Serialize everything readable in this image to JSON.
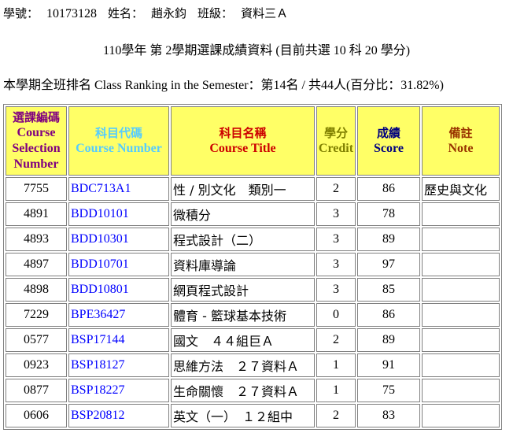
{
  "header": {
    "student_id_label": "學號：",
    "student_id": "10173128",
    "name_label": "姓名：",
    "name": "趙永鈞",
    "class_label": "班級：",
    "class_name": "資料三Ａ"
  },
  "subtitle": "110學年 第 2學期選課成績資料 (目前共選 10 科 20 學分)",
  "ranking": "本學期全班排名 Class Ranking in the Semester：第14名 / 共44人(百分比：31.82%)",
  "table": {
    "headers": {
      "selection": [
        "選課編碼",
        "Course",
        "Selection",
        "Number"
      ],
      "course_number": [
        "科目代碼",
        "Course Number"
      ],
      "course_title": [
        "科目名稱",
        "Course Title"
      ],
      "credit": [
        "學分",
        "Credit"
      ],
      "score": [
        "成績",
        "Score"
      ],
      "note": [
        "備註",
        "Note"
      ]
    },
    "rows": [
      {
        "code": "7755",
        "number": "BDC713A1",
        "title": "性 / 別文化　類別一",
        "credit": "2",
        "score": "86",
        "note": "歷史與文化"
      },
      {
        "code": "4891",
        "number": "BDD10101",
        "title": "微積分",
        "credit": "3",
        "score": "78",
        "note": ""
      },
      {
        "code": "4893",
        "number": "BDD10301",
        "title": "程式設計（二）",
        "credit": "3",
        "score": "89",
        "note": ""
      },
      {
        "code": "4897",
        "number": "BDD10701",
        "title": "資料庫導論",
        "credit": "3",
        "score": "97",
        "note": ""
      },
      {
        "code": "4898",
        "number": "BDD10801",
        "title": "網頁程式設計",
        "credit": "3",
        "score": "85",
        "note": ""
      },
      {
        "code": "7229",
        "number": "BPE36427",
        "title": "體育 - 籃球基本技術",
        "credit": "0",
        "score": "86",
        "note": ""
      },
      {
        "code": "0577",
        "number": "BSP17144",
        "title": "國文　４４組巨Ａ",
        "credit": "2",
        "score": "89",
        "note": ""
      },
      {
        "code": "0923",
        "number": "BSP18127",
        "title": "思維方法　２７資料Ａ",
        "credit": "1",
        "score": "91",
        "note": ""
      },
      {
        "code": "0877",
        "number": "BSP18227",
        "title": "生命關懷　２７資料Ａ",
        "credit": "1",
        "score": "75",
        "note": ""
      },
      {
        "code": "0606",
        "number": "BSP20812",
        "title": "英文（一）　１２組中",
        "credit": "2",
        "score": "83",
        "note": ""
      }
    ]
  }
}
